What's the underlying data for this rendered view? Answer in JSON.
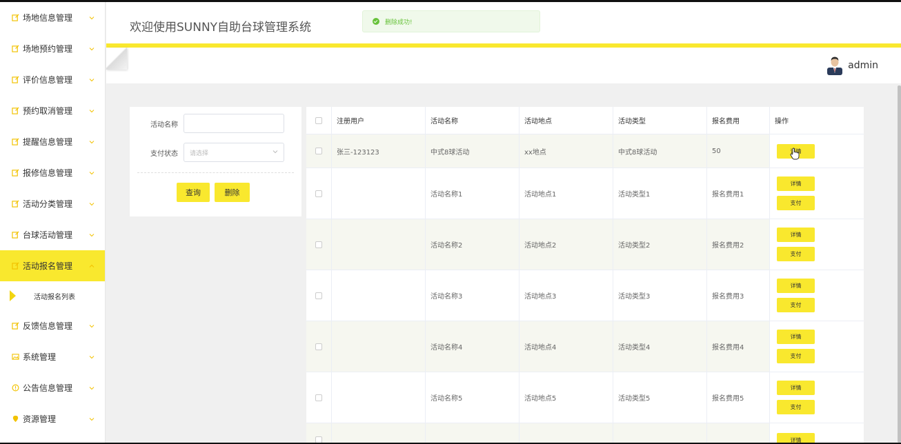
{
  "app": {
    "title": "欢迎使用SUNNY自助台球管理系统",
    "user": "admin"
  },
  "toast": {
    "message": "删除成功!"
  },
  "sidebar": {
    "items": [
      {
        "label": "场地信息管理",
        "icon": "edit-icon"
      },
      {
        "label": "场地预约管理",
        "icon": "edit-icon"
      },
      {
        "label": "评价信息管理",
        "icon": "edit-icon"
      },
      {
        "label": "预约取消管理",
        "icon": "edit-icon"
      },
      {
        "label": "提醒信息管理",
        "icon": "edit-icon"
      },
      {
        "label": "报修信息管理",
        "icon": "edit-icon"
      },
      {
        "label": "活动分类管理",
        "icon": "edit-icon"
      },
      {
        "label": "台球活动管理",
        "icon": "edit-icon"
      },
      {
        "label": "活动报名管理",
        "icon": "edit-icon",
        "active": true
      },
      {
        "label": "反馈信息管理",
        "icon": "edit-icon"
      },
      {
        "label": "系统管理",
        "icon": "picture-icon"
      },
      {
        "label": "公告信息管理",
        "icon": "warning-icon"
      },
      {
        "label": "资源管理",
        "icon": "location-icon"
      }
    ],
    "subitem": {
      "label": "活动报名列表"
    }
  },
  "search": {
    "name_label": "活动名称",
    "name_value": "",
    "pay_label": "支付状态",
    "pay_placeholder": "请选择",
    "query_button": "查询",
    "delete_button": "删除"
  },
  "table": {
    "headers": [
      "注册用户",
      "活动名称",
      "活动地点",
      "活动类型",
      "报名费用",
      "操作"
    ],
    "rows": [
      {
        "user": "张三-123123",
        "name": "中式8球活动",
        "place": "xx地点",
        "type": "中式8球活动",
        "fee": "50",
        "ops": [
          "详情"
        ]
      },
      {
        "user": "",
        "name": "活动名称1",
        "place": "活动地点1",
        "type": "活动类型1",
        "fee": "报名费用1",
        "ops": [
          "详情",
          "支付"
        ]
      },
      {
        "user": "",
        "name": "活动名称2",
        "place": "活动地点2",
        "type": "活动类型2",
        "fee": "报名费用2",
        "ops": [
          "详情",
          "支付"
        ]
      },
      {
        "user": "",
        "name": "活动名称3",
        "place": "活动地点3",
        "type": "活动类型3",
        "fee": "报名费用3",
        "ops": [
          "详情",
          "支付"
        ]
      },
      {
        "user": "",
        "name": "活动名称4",
        "place": "活动地点4",
        "type": "活动类型4",
        "fee": "报名费用4",
        "ops": [
          "详情",
          "支付"
        ]
      },
      {
        "user": "",
        "name": "活动名称5",
        "place": "活动地点5",
        "type": "活动类型5",
        "fee": "报名费用5",
        "ops": [
          "详情",
          "支付"
        ]
      },
      {
        "user": "",
        "name": "",
        "place": "",
        "type": "",
        "fee": "",
        "ops": [
          "详情"
        ]
      }
    ]
  },
  "colors": {
    "accent": "#f9e82e",
    "success": "#67c23a"
  }
}
